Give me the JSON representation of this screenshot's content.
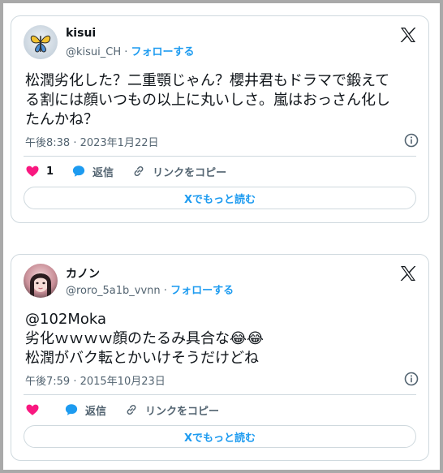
{
  "tweets": [
    {
      "author_name": "kisui",
      "handle": "@kisui_CH",
      "separator": "·",
      "follow_label": "フォローする",
      "text_lines": [
        "松潤劣化した？二重顎じゃん？櫻井君もドラマで鍛えて",
        "る割には顔いつもの以上に丸いしさ。嵐はおっさん化し",
        "たんかね？"
      ],
      "timestamp": "午後8:38 · 2023年1月22日",
      "like_count": "1",
      "reply_label": "返信",
      "copy_link_label": "リンクをコピー",
      "read_more_label": "Xでもっと読む"
    },
    {
      "author_name": "カノン",
      "handle": "@roro_5a1b_vvnn",
      "separator": "·",
      "follow_label": "フォローする",
      "text_lines": [
        "@102Moka",
        "劣化ｗｗｗｗ顔のたるみ具合な😂😂",
        "松潤がバク転とかいけそうだけどね"
      ],
      "timestamp": "午後7:59 · 2015年10月23日",
      "like_count": "",
      "reply_label": "返信",
      "copy_link_label": "リンクをコピー",
      "read_more_label": "Xでもっと読む"
    }
  ],
  "colors": {
    "accent": "#1d9bf0",
    "like": "#f91880",
    "muted": "#536471",
    "border": "#cfd9de"
  },
  "icons": [
    "butterfly-avatar",
    "x-logo-icon",
    "info-icon",
    "heart-icon",
    "reply-bubble-icon",
    "link-icon"
  ]
}
